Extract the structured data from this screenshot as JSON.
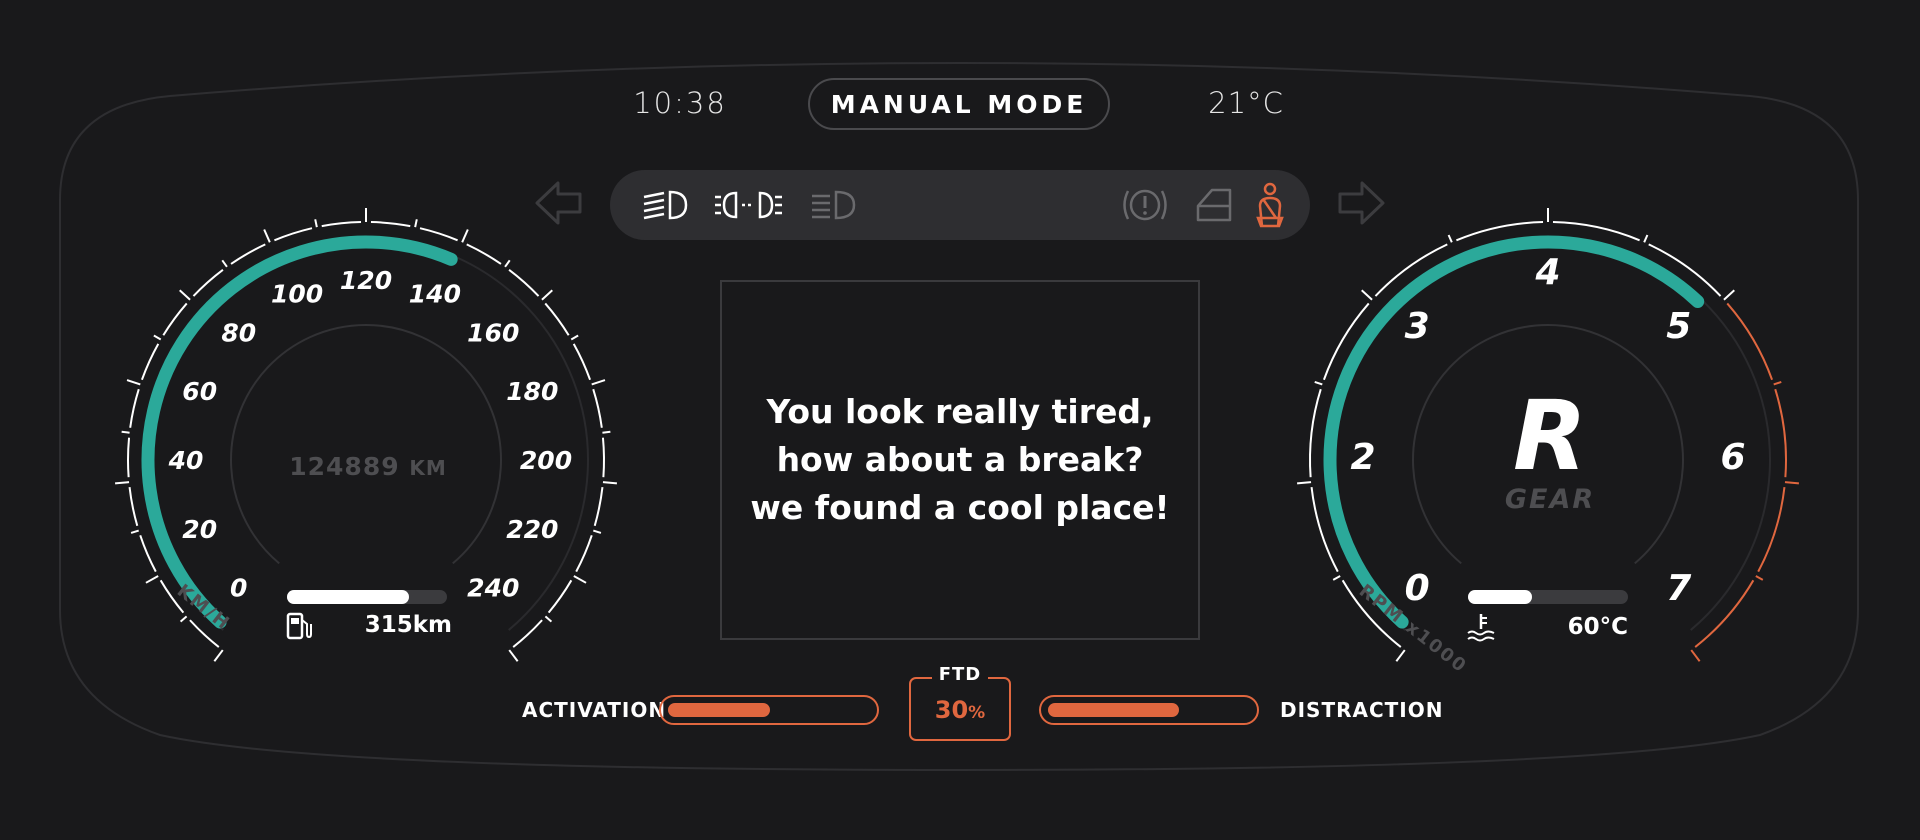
{
  "header": {
    "clock": "10:38",
    "mode": "MANUAL MODE",
    "temperature": "21°C"
  },
  "indicators": {
    "left_turn": "arrow-left-icon",
    "right_turn": "arrow-right-icon",
    "icons": [
      "low-beam-icon",
      "parking-lights-icon",
      "high-beam-icon",
      "brake-warning-icon",
      "door-open-icon",
      "seatbelt-warning-icon"
    ],
    "warning_color": "#e0673f"
  },
  "speedometer": {
    "ticks": [
      "0",
      "20",
      "40",
      "60",
      "80",
      "100",
      "120",
      "140",
      "160",
      "180",
      "200",
      "220",
      "240"
    ],
    "unit": "KM/H",
    "odometer_value": "124889",
    "odometer_unit": "KM",
    "speed_value": 140,
    "max": 240,
    "accent_color": "#2ba99a",
    "fuel_level": 0.76,
    "fuel_range": "315km"
  },
  "tachometer": {
    "ticks": [
      "0",
      "2",
      "3",
      "4",
      "5",
      "6",
      "7"
    ],
    "unit": "RPM x1000",
    "rpm_value": 4.6,
    "max": 7,
    "gear": "R",
    "gear_label": "GEAR",
    "coolant_level": 0.4,
    "coolant_temp": "60°C"
  },
  "message": {
    "lines": [
      "You look really tired,",
      "how about a break?",
      "we found a cool place!"
    ]
  },
  "meters": {
    "activation_label": "ACTIVATION",
    "activation_level": 0.5,
    "distraction_label": "DISTRACTION",
    "distraction_level": 0.64,
    "ftd_label": "FTD",
    "ftd_value": "30",
    "ftd_unit": "%"
  }
}
